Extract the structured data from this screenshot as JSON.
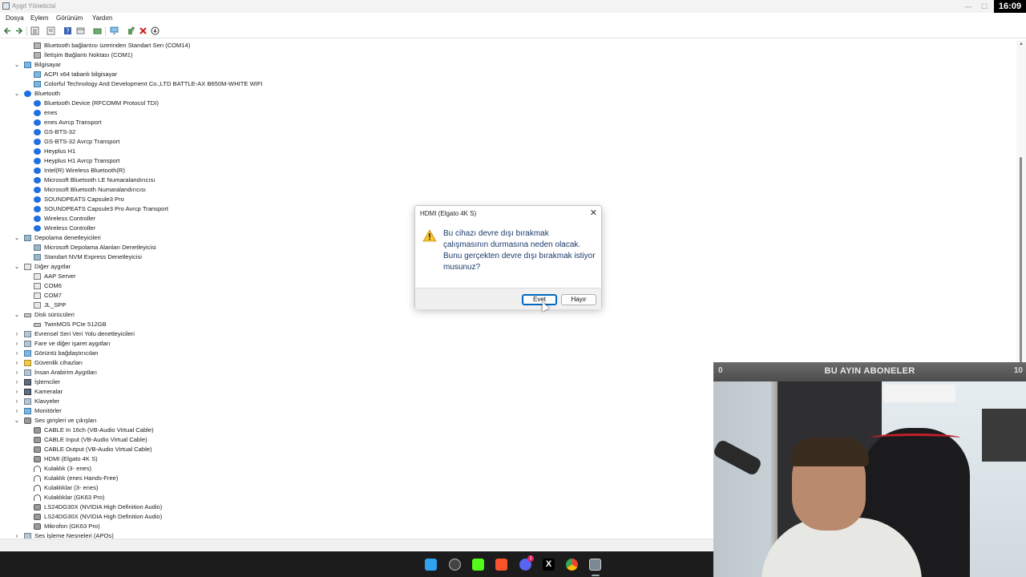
{
  "window": {
    "title": "Aygıt Yöneticisi",
    "clock": "16:09",
    "min": "—",
    "max": "☐",
    "close": "✕"
  },
  "menu": [
    "Dosya",
    "Eylem",
    "Görünüm",
    "Yardım"
  ],
  "tree": [
    {
      "label": "Bluetooth bağlantısı üzerinden Standart Seri (COM14)",
      "level": 2,
      "icon": "port"
    },
    {
      "label": "İletişim Bağlantı Noktası (COM1)",
      "level": 2,
      "icon": "port"
    },
    {
      "label": "Bilgisayar",
      "level": 1,
      "expanded": true,
      "icon": "monitor"
    },
    {
      "label": "ACPI x64 tabanlı bilgisayar",
      "level": 2,
      "icon": "monitor"
    },
    {
      "label": "Colorful Technology And Development Co.,LTD BATTLE-AX B650M-WHITE WIFI",
      "level": 2,
      "icon": "monitor"
    },
    {
      "label": "Bluetooth",
      "level": 1,
      "expanded": true,
      "icon": "bt"
    },
    {
      "label": "Bluetooth Device (RFCOMM Protocol TDI)",
      "level": 2,
      "icon": "bt"
    },
    {
      "label": "enes",
      "level": 2,
      "icon": "bt"
    },
    {
      "label": "enes Avrcp Transport",
      "level": 2,
      "icon": "bt"
    },
    {
      "label": "GS-BTS-32",
      "level": 2,
      "icon": "bt"
    },
    {
      "label": "GS-BTS-32 Avrcp Transport",
      "level": 2,
      "icon": "bt"
    },
    {
      "label": "Heyplus H1",
      "level": 2,
      "icon": "bt"
    },
    {
      "label": "Heyplus H1 Avrcp Transport",
      "level": 2,
      "icon": "bt"
    },
    {
      "label": "Intel(R) Wireless Bluetooth(R)",
      "level": 2,
      "icon": "bt"
    },
    {
      "label": "Microsoft Bluetooth LE Numaralandırıcısı",
      "level": 2,
      "icon": "bt"
    },
    {
      "label": "Microsoft Bluetooth Numaralandırıcısı",
      "level": 2,
      "icon": "bt"
    },
    {
      "label": "SOUNDPEATS Capsule3 Pro",
      "level": 2,
      "icon": "bt"
    },
    {
      "label": "SOUNDPEATS Capsule3 Pro Avrcp Transport",
      "level": 2,
      "icon": "bt"
    },
    {
      "label": "Wireless Controller",
      "level": 2,
      "icon": "bt"
    },
    {
      "label": "Wireless Controller",
      "level": 2,
      "icon": "bt"
    },
    {
      "label": "Depolama denetleyicileri",
      "level": 1,
      "expanded": true,
      "icon": "ctrl"
    },
    {
      "label": "Microsoft Depolama Alanları Denetleyicisi",
      "level": 2,
      "icon": "ctrl"
    },
    {
      "label": "Standart NVM Express Denetleyicisi",
      "level": 2,
      "icon": "ctrl"
    },
    {
      "label": "Diğer aygıtlar",
      "level": 1,
      "expanded": true,
      "icon": "unknown"
    },
    {
      "label": "AAP Server",
      "level": 2,
      "icon": "unknown"
    },
    {
      "label": "COM6",
      "level": 2,
      "icon": "unknown"
    },
    {
      "label": "COM7",
      "level": 2,
      "icon": "unknown"
    },
    {
      "label": "JL_SPP",
      "level": 2,
      "icon": "unknown"
    },
    {
      "label": "Disk sürücüleri",
      "level": 1,
      "expanded": true,
      "icon": "disk"
    },
    {
      "label": "TwinMOS PCIe 512GB",
      "level": 2,
      "icon": "disk"
    },
    {
      "label": "Evrensel Seri Veri Yolu denetleyicileri",
      "level": 1,
      "expanded": false,
      "icon": "gen"
    },
    {
      "label": "Fare ve diğer işaret aygıtları",
      "level": 1,
      "expanded": false,
      "icon": "gen"
    },
    {
      "label": "Görüntü bağdaştırıcıları",
      "level": 1,
      "expanded": false,
      "icon": "monitor"
    },
    {
      "label": "Güvenlik cihazları",
      "level": 1,
      "expanded": false,
      "icon": "yellow"
    },
    {
      "label": "İnsan Arabirim Aygıtları",
      "level": 1,
      "expanded": false,
      "icon": "gen"
    },
    {
      "label": "İşlemciler",
      "level": 1,
      "expanded": false,
      "icon": "chip"
    },
    {
      "label": "Kameralar",
      "level": 1,
      "expanded": false,
      "icon": "chip"
    },
    {
      "label": "Klavyeler",
      "level": 1,
      "expanded": false,
      "icon": "gen"
    },
    {
      "label": "Monitörler",
      "level": 1,
      "expanded": false,
      "icon": "monitor"
    },
    {
      "label": "Ses girişleri ve çıkışları",
      "level": 1,
      "expanded": true,
      "icon": "audio"
    },
    {
      "label": "CABLE In 16ch (VB-Audio Virtual Cable)",
      "level": 2,
      "icon": "audio"
    },
    {
      "label": "CABLE Input (VB-Audio Virtual Cable)",
      "level": 2,
      "icon": "audio"
    },
    {
      "label": "CABLE Output (VB-Audio Virtual Cable)",
      "level": 2,
      "icon": "audio"
    },
    {
      "label": "HDMI (Elgato 4K S)",
      "level": 2,
      "icon": "audio"
    },
    {
      "label": "Kulaklık (3- enes)",
      "level": 2,
      "icon": "headset"
    },
    {
      "label": "Kulaklık (enes Hands-Free)",
      "level": 2,
      "icon": "headset"
    },
    {
      "label": "Kulaklıklar (3- enes)",
      "level": 2,
      "icon": "headset"
    },
    {
      "label": "Kulaklıklar (GK63 Pro)",
      "level": 2,
      "icon": "headset"
    },
    {
      "label": "LS24DG30X (NVIDIA High Definition Audio)",
      "level": 2,
      "icon": "audio"
    },
    {
      "label": "LS24DG30X (NVIDIA High Definition Audio)",
      "level": 2,
      "icon": "audio"
    },
    {
      "label": "Mikrofon (GK63 Pro)",
      "level": 2,
      "icon": "audio"
    },
    {
      "label": "Ses İşleme Nesneleri (APOs)",
      "level": 1,
      "expanded": false,
      "icon": "gen"
    }
  ],
  "dialog": {
    "title": "HDMI (Elgato 4K S)",
    "close": "✕",
    "message": "Bu cihazı devre dışı bırakmak çalışmasının durmasına neden olacak. Bunu gerçekten devre dışı bırakmak istiyor musunuz?",
    "yes": "Evet",
    "no": "Hayır"
  },
  "overlay": {
    "left_count": "0",
    "title": "BU AYIN ABONELER",
    "right_count": "10"
  }
}
